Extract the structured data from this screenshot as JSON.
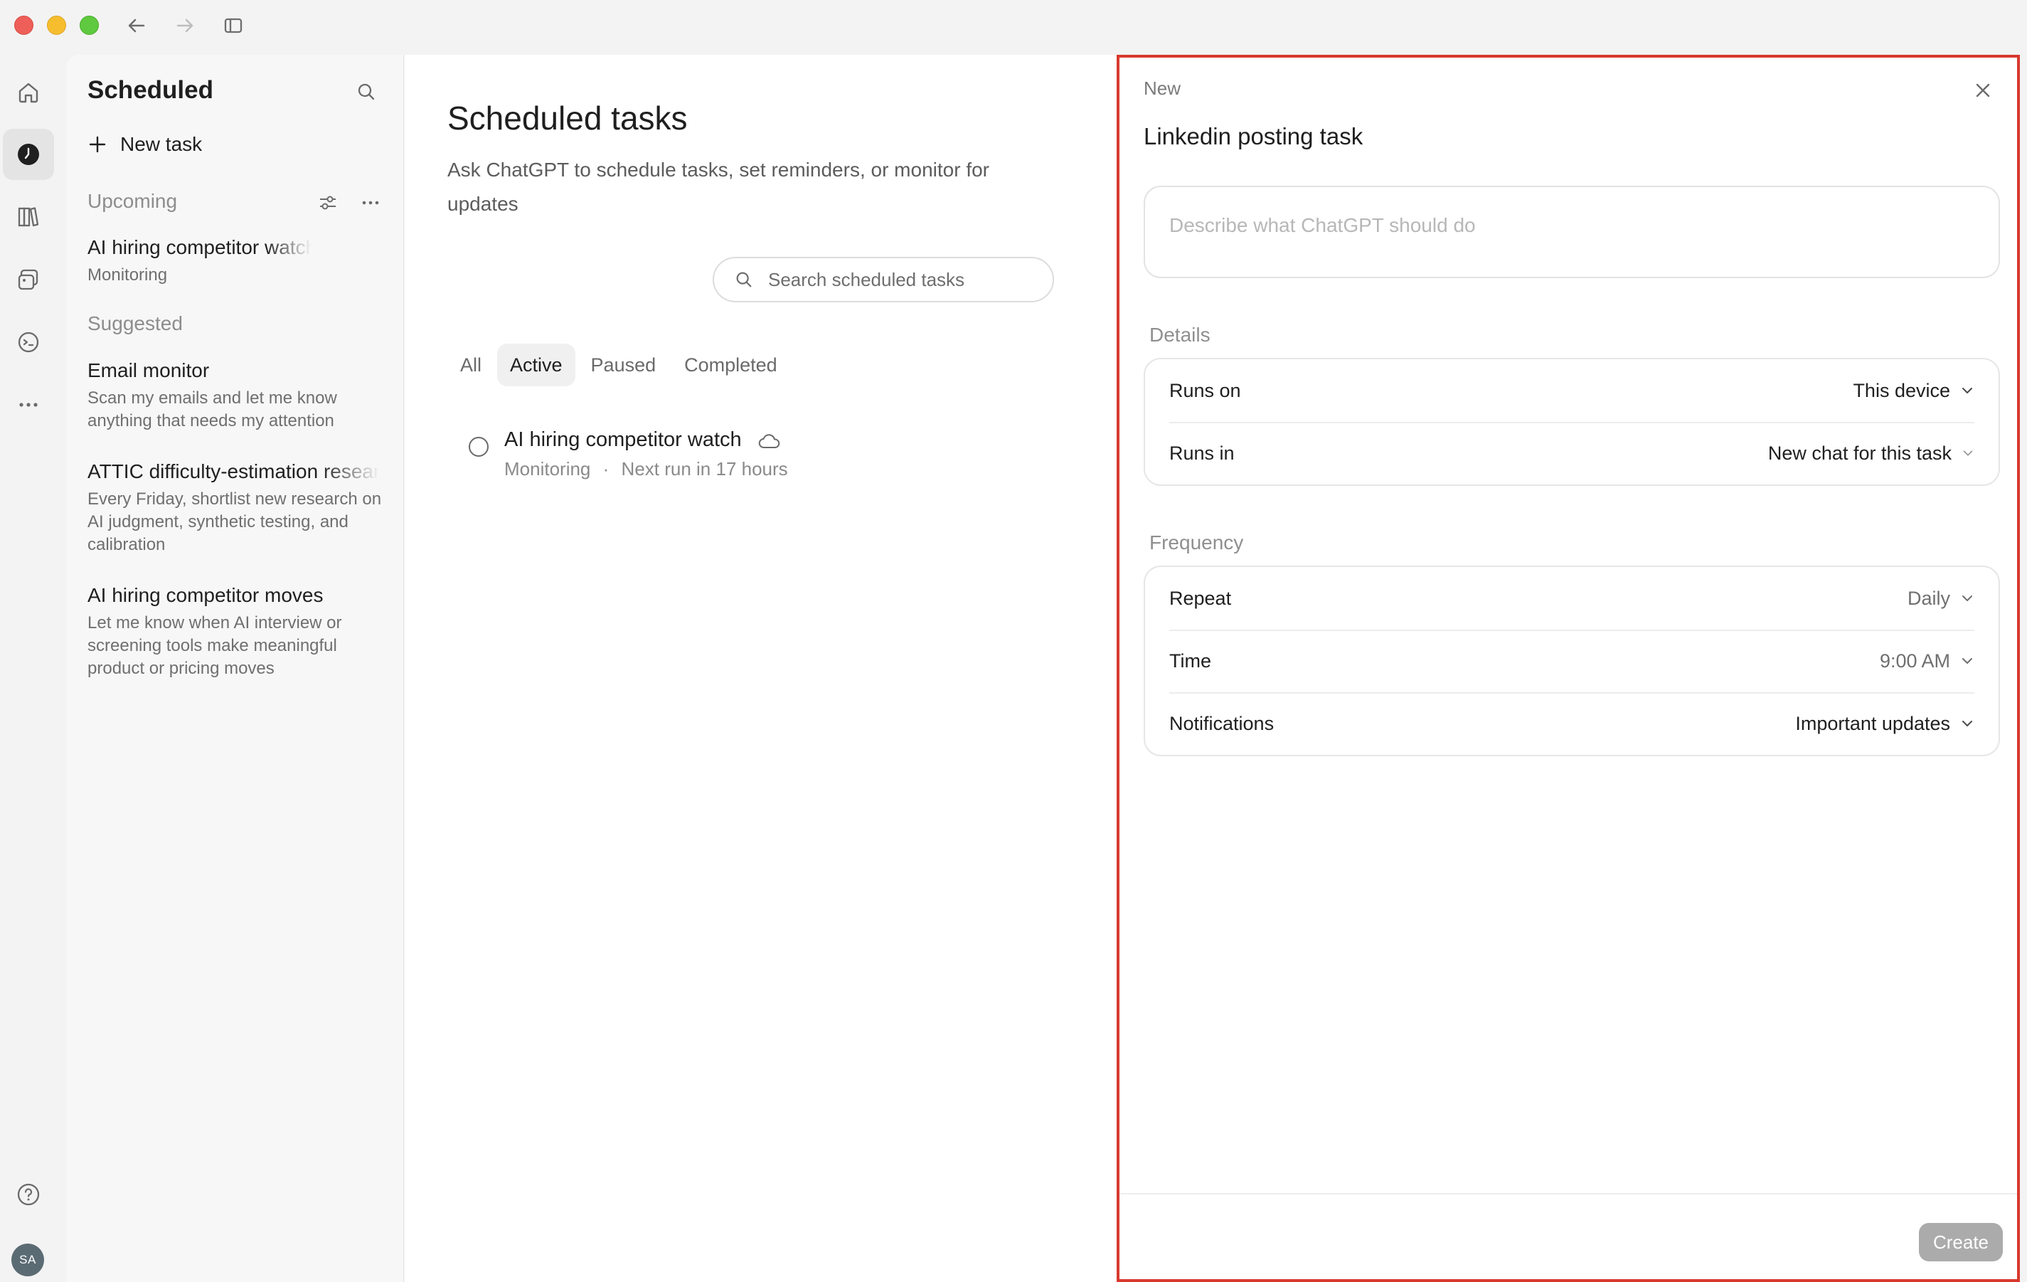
{
  "sidebar": {
    "title": "Scheduled",
    "new_task": "New task",
    "upcoming_label": "Upcoming",
    "upcoming": [
      {
        "title": "AI hiring competitor watch",
        "subtitle": "Monitoring"
      }
    ],
    "suggested_label": "Suggested",
    "suggested": [
      {
        "title": "Email monitor",
        "subtitle": "Scan my emails and let me know anything that needs my attention"
      },
      {
        "title": "ATTIC difficulty-estimation research",
        "subtitle": "Every Friday, shortlist new research on AI judgment, synthetic testing, and calibration"
      },
      {
        "title": "AI hiring competitor moves",
        "subtitle": "Let me know when AI interview or screening tools make meaningful product or pricing moves"
      }
    ]
  },
  "user": {
    "initials": "SA"
  },
  "main": {
    "title": "Scheduled tasks",
    "subtitle": "Ask ChatGPT to schedule tasks, set reminders, or monitor for updates",
    "search_placeholder": "Search scheduled tasks",
    "tabs": [
      "All",
      "Active",
      "Paused",
      "Completed"
    ],
    "active_tab": "Active",
    "tasks": [
      {
        "title": "AI hiring competitor watch",
        "type": "Monitoring",
        "separator": "·",
        "next_run": "Next run in 17 hours"
      }
    ]
  },
  "panel": {
    "kicker": "New",
    "title": "Linkedin posting task",
    "description_placeholder": "Describe what ChatGPT should do",
    "details_label": "Details",
    "runs_on_label": "Runs on",
    "runs_on_value": "This device",
    "runs_in_label": "Runs in",
    "runs_in_value": "New chat for this task",
    "frequency_label": "Frequency",
    "repeat_label": "Repeat",
    "repeat_value": "Daily",
    "time_label": "Time",
    "time_value": "9:00 AM",
    "notifications_label": "Notifications",
    "notifications_value": "Important updates",
    "create_label": "Create"
  },
  "colors": {
    "highlight_border": "#d9392e",
    "create_button_disabled": "#ababab"
  }
}
